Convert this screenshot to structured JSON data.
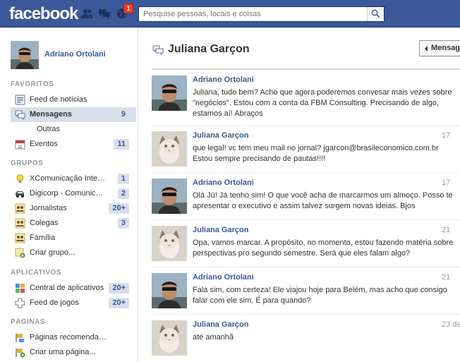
{
  "topbar": {
    "logo": "facebook",
    "notification_count": "1",
    "search_placeholder": "Pesquise pessoas, locais e coisas"
  },
  "sidebar": {
    "profile_name": "Adriano Ortolani",
    "sections": {
      "favoritos": "FAVORITOS",
      "grupos": "GRUPOS",
      "aplicativos": "APLICATIVOS",
      "paginas": "PÁGINAS"
    },
    "favoritos": [
      {
        "label": "Feed de notícias",
        "icon": "news-feed-icon",
        "count": ""
      },
      {
        "label": "Mensagens",
        "icon": "messages-icon",
        "count": "9"
      },
      {
        "label": "Outras",
        "icon": "",
        "count": ""
      },
      {
        "label": "Eventos",
        "icon": "calendar-icon",
        "count": "11"
      }
    ],
    "grupos": [
      {
        "label": "XComunicação Interna",
        "icon": "lightbulb-icon",
        "count": "1"
      },
      {
        "label": "Digicorp - Comunicaç...",
        "icon": "car-icon",
        "count": "2"
      },
      {
        "label": "Jornalistas",
        "icon": "group-icon",
        "count": "20+"
      },
      {
        "label": "Colegas",
        "icon": "group-icon",
        "count": "3"
      },
      {
        "label": "Família",
        "icon": "group-icon",
        "count": ""
      },
      {
        "label": "Criar grupo...",
        "icon": "create-group-icon",
        "count": ""
      }
    ],
    "aplicativos": [
      {
        "label": "Central de aplicativos",
        "icon": "app-center-icon",
        "count": "20+"
      },
      {
        "label": "Feed de jogos",
        "icon": "games-icon",
        "count": "20+"
      }
    ],
    "paginas": [
      {
        "label": "Páginas recomendadas",
        "icon": "pages-icon",
        "count": ""
      },
      {
        "label": "Criar uma página...",
        "icon": "create-page-icon",
        "count": ""
      }
    ]
  },
  "conversation": {
    "title": "Juliana Garçon",
    "button_label": "Mensagem",
    "messages": [
      {
        "author": "Adriano Ortolani",
        "time": "",
        "text": "Juliana, tudo bem? Acho que agora poderemos convesar mais vezes sobre \"negócios\". Estou com a conta da FBM Consulting. Precisando de algo, estamos aí! Abraços"
      },
      {
        "author": "Juliana Garçon",
        "time": "17",
        "text": "que legal! vc tem meu mail no jornal? jgarcon@brasileconomico.com.br Estou sempre precisando de pautas!!!!"
      },
      {
        "author": "Adriano Ortolani",
        "time": "17",
        "text": "Olá Jú! Já tenho sim! O que você acha de marcarmos um almoço. Posso te apresentar o executivo e assim talvez surgem novas ideias. Bjos"
      },
      {
        "author": "Juliana Garçon",
        "time": "21",
        "text": "Opa, vamos marcar. A propósito, no momento, estou fazendo matéria sobre perspectivas pro segundo semestre. Será que eles falam algo?"
      },
      {
        "author": "Adriano Ortolani",
        "time": "21",
        "text": "Fala sim, com certeza! Ele viajou hoje para Belém, mas acho que consigo falar com ele sim. É para quando?"
      },
      {
        "author": "Juliana Garçon",
        "time": "23 de",
        "text": "até amanhã"
      }
    ]
  },
  "colors": {
    "brand_blue": "#3b5998",
    "nav_highlight": "#d8dfea",
    "notification_red": "#f03d25"
  }
}
